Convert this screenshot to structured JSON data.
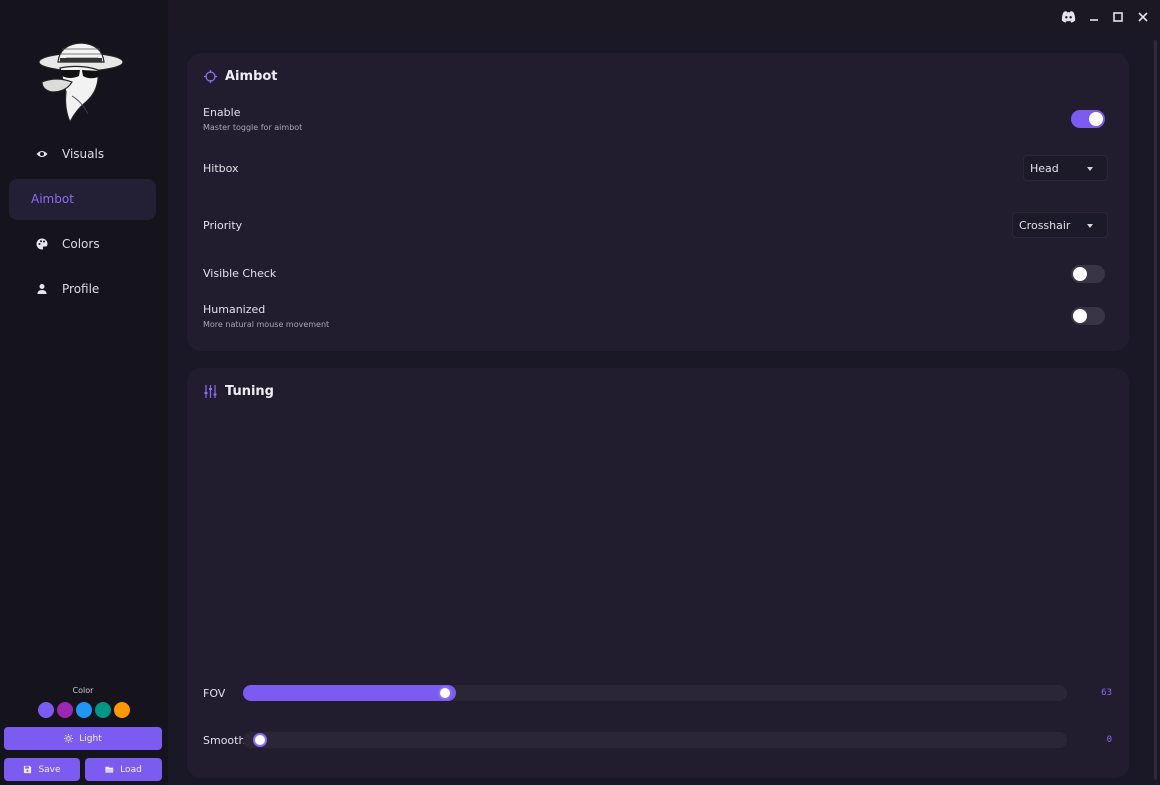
{
  "sidebar": {
    "items": [
      {
        "label": "Visuals",
        "icon": "eye-icon"
      },
      {
        "label": "Aimbot",
        "icon": "crosshair-icon",
        "active": true
      },
      {
        "label": "Colors",
        "icon": "palette-icon"
      },
      {
        "label": "Profile",
        "icon": "person-icon"
      }
    ],
    "color_title": "Color",
    "swatches": [
      "#7c5cf0",
      "#9c27b0",
      "#2196f3",
      "#009688",
      "#ff9800"
    ],
    "theme_button": "Light",
    "save_button": "Save",
    "load_button": "Load"
  },
  "aimbot": {
    "title": "Aimbot",
    "enable": {
      "label": "Enable",
      "sub": "Master toggle for aimbot",
      "on": true
    },
    "hitbox": {
      "label": "Hitbox",
      "value": "Head"
    },
    "priority": {
      "label": "Priority",
      "value": "Crosshair"
    },
    "visible_check": {
      "label": "Visible Check",
      "on": false
    },
    "humanized": {
      "label": "Humanized",
      "sub": "More natural mouse movement",
      "on": false
    }
  },
  "tuning": {
    "title": "Tuning",
    "fov": {
      "label": "FOV",
      "value": "63",
      "fraction": 0.246
    },
    "smooth": {
      "label": "Smooth",
      "value": "0",
      "fraction": 0.0
    }
  },
  "colors": {
    "accent": "#7c5cf0"
  }
}
